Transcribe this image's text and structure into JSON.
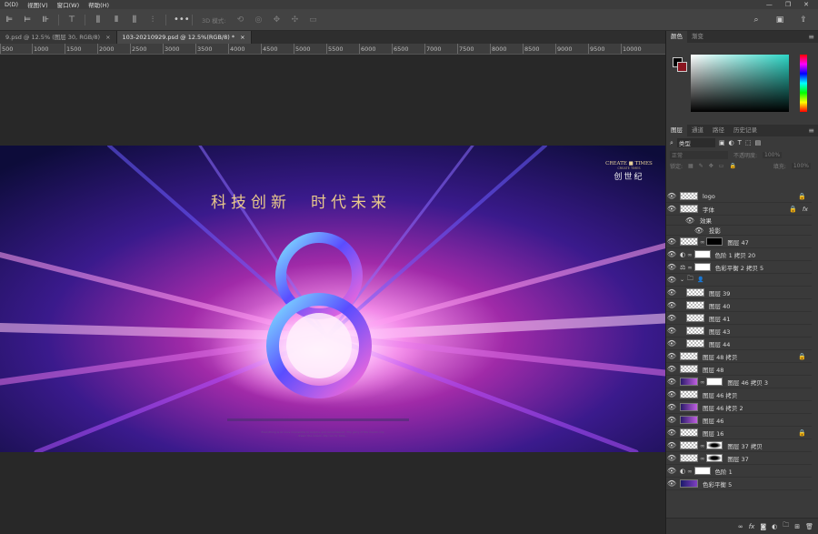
{
  "menu": [
    "D(D)",
    "视图(V)",
    "窗口(W)",
    "帮助(H)"
  ],
  "options": {
    "mode3d": "3D 模式:"
  },
  "tabs": [
    {
      "label": "9.psd @ 12.5% (图层 30, RGB/8)",
      "active": false
    },
    {
      "label": "103-20210929.psd @ 12.5%(RGB/8) *",
      "active": true
    }
  ],
  "ruler": [
    "500",
    "1000",
    "1500",
    "2000",
    "2500",
    "3000",
    "3500",
    "4000",
    "4500",
    "5000",
    "5500",
    "6000",
    "6500",
    "7000",
    "7500",
    "8000",
    "8500",
    "9000",
    "9500",
    "10000"
  ],
  "artwork": {
    "headline": "科技创新　时代未来",
    "logo_en": "CREATE ■ TIMES",
    "logo_sub": "CREATE TIMES",
    "logo_cn": "创世纪",
    "big_digit": "8",
    "small_text": "Everything is at once impossible to explore and remembered. The glory of the dream, the dream the dream. We can for time..."
  },
  "color_panel": {
    "tabs": [
      "颜色",
      "渐变"
    ],
    "spectrum_color": "#2dd6c6"
  },
  "layers_panel": {
    "tabs": [
      "图层",
      "通道",
      "路径",
      "历史记录"
    ],
    "filter": "类型",
    "blend": "正常",
    "opacity_label": "不透明度:",
    "opacity": "100%",
    "lock_label": "锁定:",
    "fill_label": "填充:",
    "fill": "100%",
    "layers": [
      {
        "name": "logo",
        "lock": "🔒",
        "fx": ""
      },
      {
        "name": "字体",
        "lock": "🔒",
        "fx": "fx"
      },
      {
        "name": "效果",
        "lock": "",
        "fx": ""
      },
      {
        "name": "投影",
        "lock": "",
        "fx": ""
      },
      {
        "name": "图层 47",
        "lock": "",
        "fx": ""
      },
      {
        "name": "色阶 1 拷贝 20",
        "lock": "",
        "fx": ""
      },
      {
        "name": "色彩平衡 2 拷贝 5",
        "lock": "",
        "fx": ""
      },
      {
        "name": "",
        "lock": "",
        "fx": ""
      },
      {
        "name": "图层 39",
        "lock": "",
        "fx": ""
      },
      {
        "name": "图层 40",
        "lock": "",
        "fx": ""
      },
      {
        "name": "图层 41",
        "lock": "",
        "fx": ""
      },
      {
        "name": "图层 43",
        "lock": "",
        "fx": ""
      },
      {
        "name": "图层 44",
        "lock": "",
        "fx": ""
      },
      {
        "name": "图层 48 拷贝",
        "lock": "🔒",
        "fx": ""
      },
      {
        "name": "图层 48",
        "lock": "",
        "fx": ""
      },
      {
        "name": "图层 46 拷贝 3",
        "lock": "",
        "fx": ""
      },
      {
        "name": "图层 46 拷贝",
        "lock": "",
        "fx": ""
      },
      {
        "name": "图层 46 拷贝 2",
        "lock": "",
        "fx": ""
      },
      {
        "name": "图层 46",
        "lock": "",
        "fx": ""
      },
      {
        "name": "图层 16",
        "lock": "🔒",
        "fx": ""
      },
      {
        "name": "图层 37 拷贝",
        "lock": "",
        "fx": ""
      },
      {
        "name": "图层 37",
        "lock": "",
        "fx": ""
      },
      {
        "name": "色阶 1",
        "lock": "",
        "fx": ""
      },
      {
        "name": "色彩平衡 5",
        "lock": "",
        "fx": ""
      }
    ]
  }
}
